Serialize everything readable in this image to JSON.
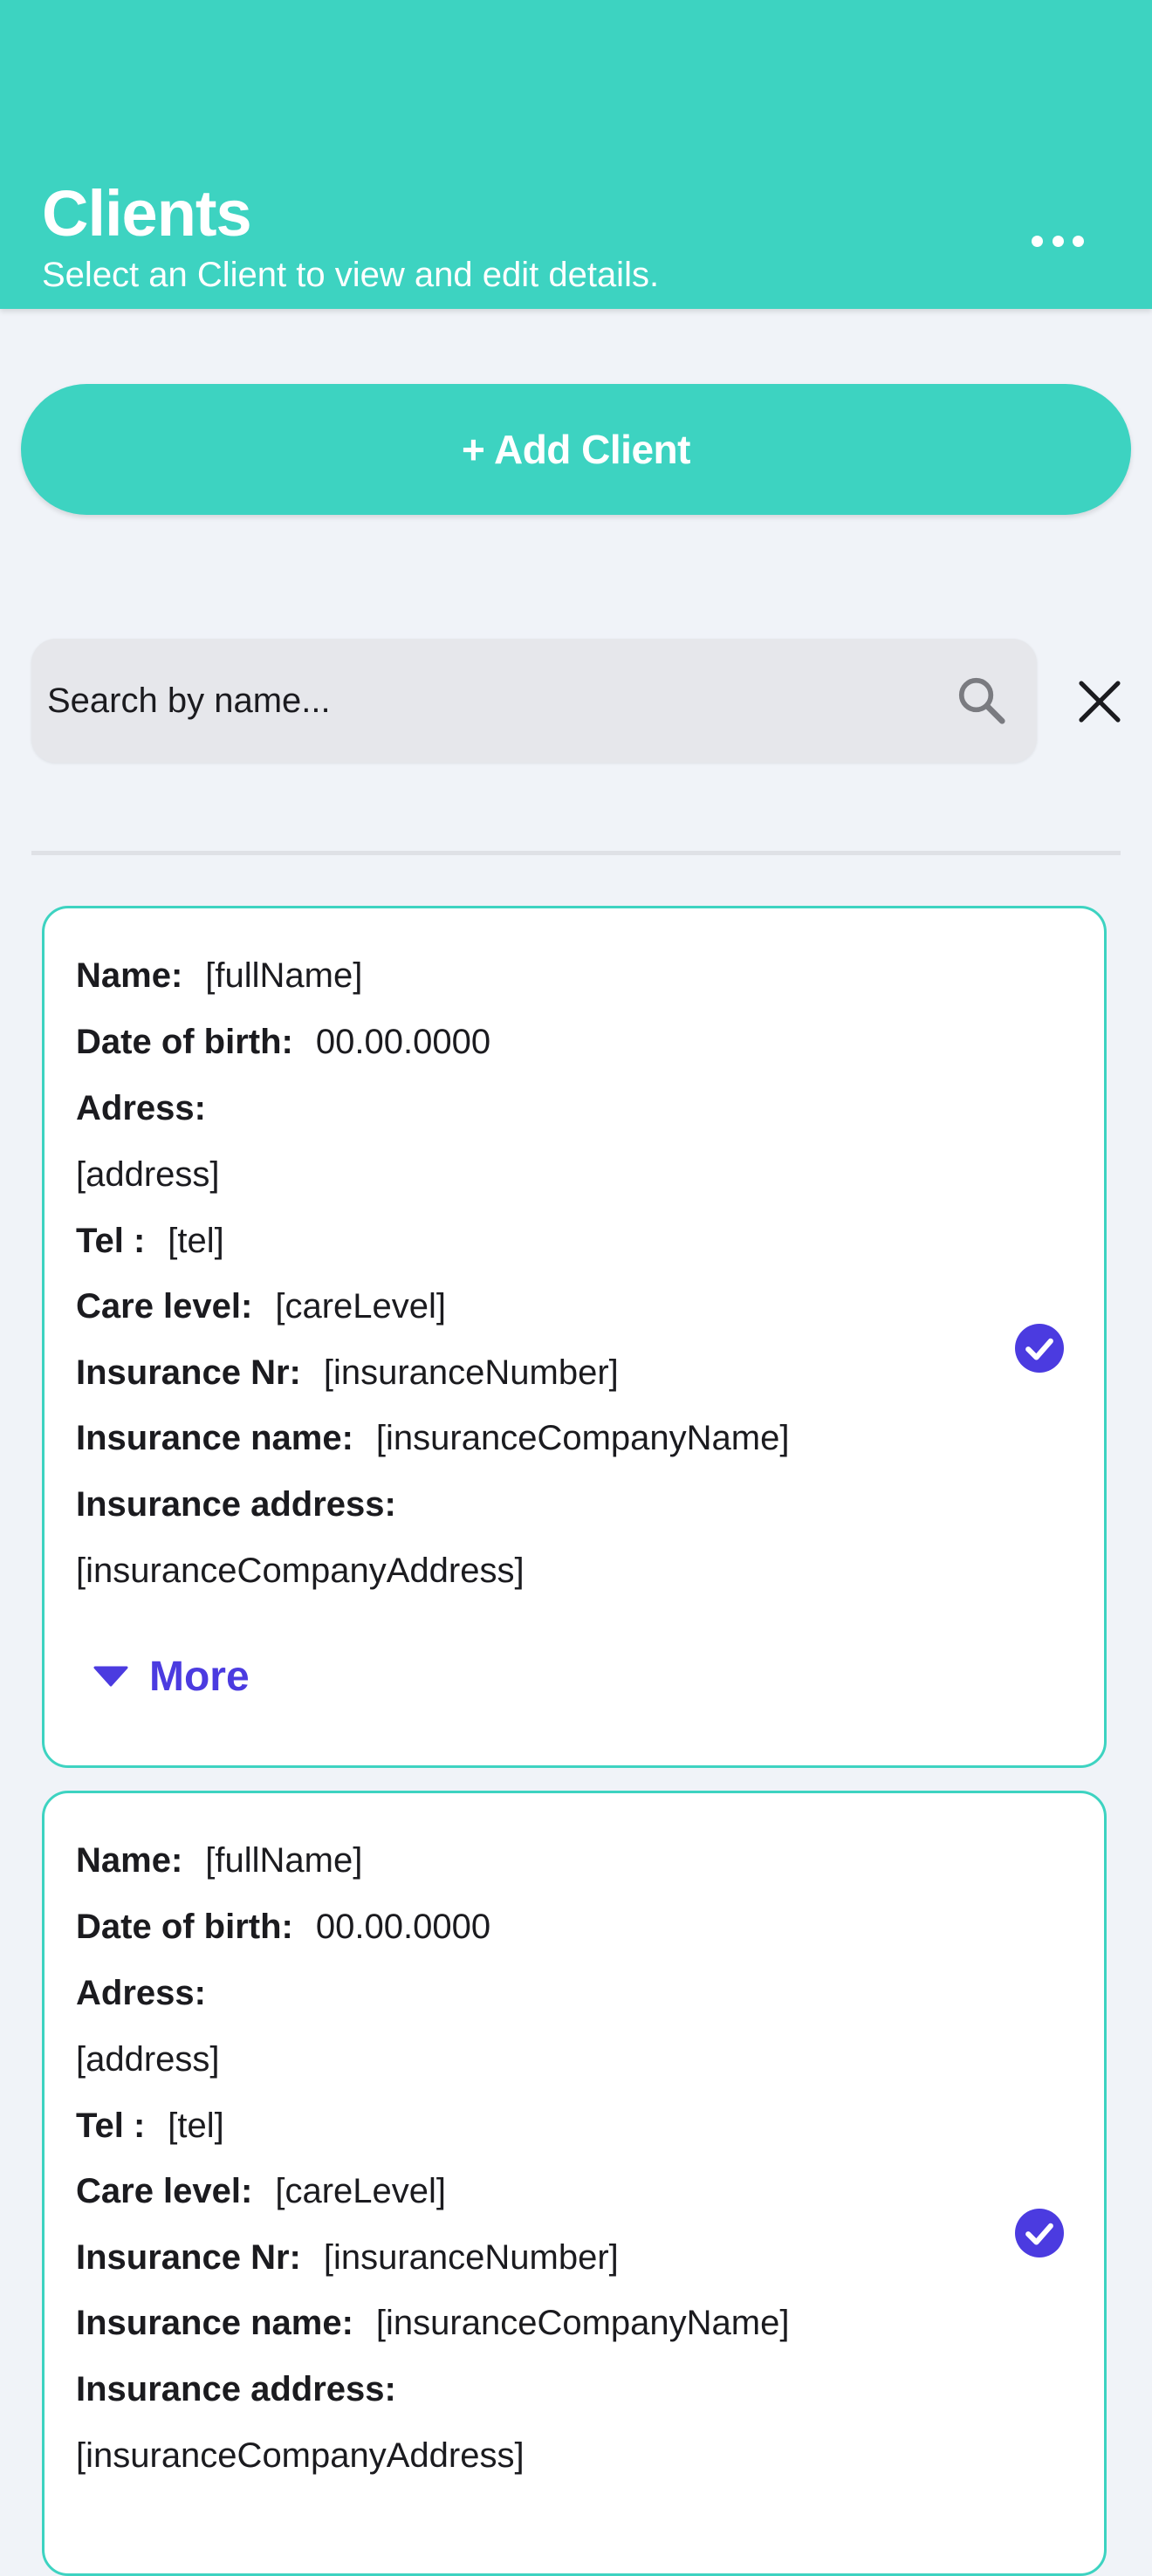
{
  "header": {
    "title": "Clients",
    "subtitle": "Select an Client to view and edit details.",
    "menu_icon": "more-horizontal-icon"
  },
  "add_button": {
    "label": "+ Add Client"
  },
  "search": {
    "value": "",
    "placeholder": "Search by name...",
    "icon": "search-icon",
    "clear_icon": "close-icon"
  },
  "labels": {
    "name": "Name:",
    "dob": "Date of birth:",
    "address": "Adress:",
    "tel": "Tel :",
    "care_level": "Care level:",
    "insurance_nr": "Insurance Nr:",
    "insurance_name": "Insurance name:",
    "insurance_address": "Insurance address:",
    "more": "More"
  },
  "colors": {
    "accent": "#3dd3c1",
    "link": "#4b3be0",
    "background": "#f0f3f8"
  },
  "clients": [
    {
      "name": "[fullName]",
      "dob": "00.00.0000",
      "address": "[address]",
      "tel": "[tel]",
      "care_level": "[careLevel]",
      "insurance_nr": "[insuranceNumber]",
      "insurance_name": "[insuranceCompanyName]",
      "insurance_address": "[insuranceCompanyAddress]",
      "selected": true
    },
    {
      "name": "[fullName]",
      "dob": "00.00.0000",
      "address": "[address]",
      "tel": "[tel]",
      "care_level": "[careLevel]",
      "insurance_nr": "[insuranceNumber]",
      "insurance_name": "[insuranceCompanyName]",
      "insurance_address": "[insuranceCompanyAddress]",
      "selected": true
    }
  ]
}
